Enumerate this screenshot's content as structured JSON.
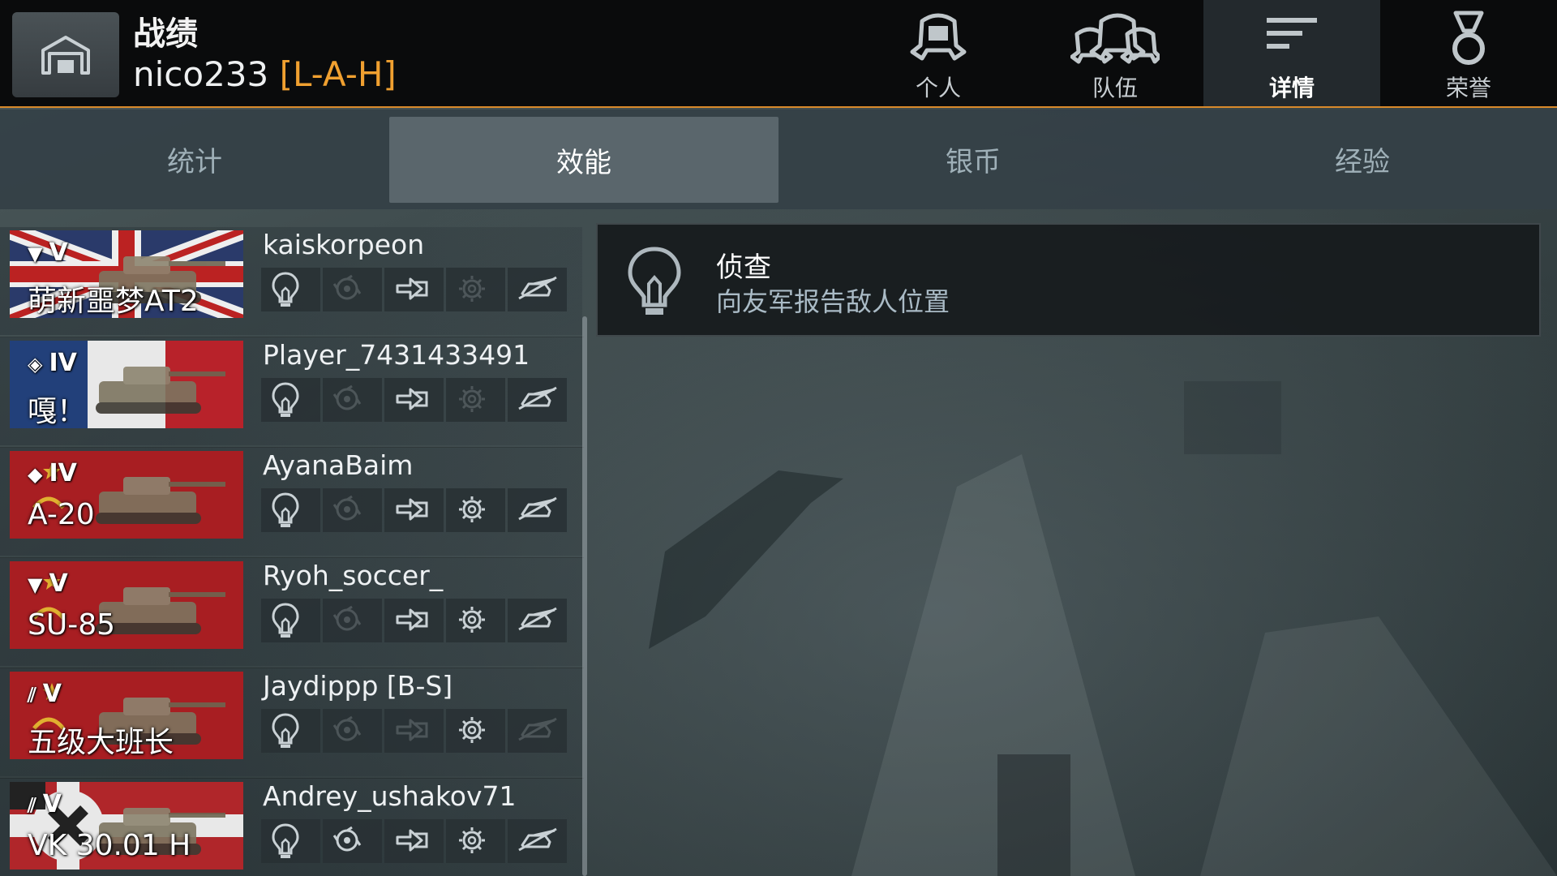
{
  "header": {
    "title": "战绩",
    "player": "nico233",
    "clan": "[L-A-H]",
    "nav": [
      {
        "label": "个人",
        "icon": "helmet-icon",
        "active": false
      },
      {
        "label": "队伍",
        "icon": "team-helmets-icon",
        "active": false
      },
      {
        "label": "详情",
        "icon": "details-lines-icon",
        "active": true
      },
      {
        "label": "荣誉",
        "icon": "medal-icon",
        "active": false
      }
    ]
  },
  "subtabs": [
    {
      "label": "统计",
      "active": false
    },
    {
      "label": "效能",
      "active": true
    },
    {
      "label": "银币",
      "active": false
    },
    {
      "label": "经验",
      "active": false
    }
  ],
  "award_types": [
    "spotting-bulb-icon",
    "assist-track-icon",
    "armor-block-icon",
    "damage-gear-icon",
    "kill-tank-icon"
  ],
  "players": [
    {
      "tank": "萌新噩梦AT2",
      "tier": "V",
      "class_icon": "td-triangle-icon",
      "nation": "uk",
      "name": "kaiskorpeon",
      "awards": [
        true,
        false,
        true,
        false,
        true
      ]
    },
    {
      "tank": "嘎！",
      "tier": "IV",
      "class_icon": "medium-tank-diamond-icon",
      "nation": "france",
      "name": "Player_7431433491",
      "awards": [
        true,
        false,
        true,
        false,
        true
      ]
    },
    {
      "tank": "A-20",
      "tier": "IV",
      "class_icon": "light-tank-diamond-icon",
      "nation": "ussr",
      "name": "AyanaBaim",
      "awards": [
        true,
        false,
        true,
        true,
        true
      ]
    },
    {
      "tank": "SU-85",
      "tier": "V",
      "class_icon": "td-triangle-icon",
      "nation": "ussr",
      "name": "Ryoh_soccer_",
      "awards": [
        true,
        false,
        true,
        true,
        true
      ]
    },
    {
      "tank": "五级大班长",
      "tier": "V",
      "class_icon": "heavy-tank-stripes-icon",
      "nation": "ussr",
      "name": "Jaydippp [B-S]",
      "awards": [
        true,
        false,
        false,
        true,
        false
      ]
    },
    {
      "tank": "VK 30.01 H",
      "tier": "V",
      "class_icon": "heavy-tank-stripes-icon",
      "nation": "germany",
      "name": "Andrey_ushakov71",
      "awards": [
        true,
        true,
        true,
        true,
        true
      ]
    }
  ],
  "detail": {
    "icon": "spotting-bulb-icon",
    "title": "侦查",
    "description": "向友军报告敌人位置"
  }
}
